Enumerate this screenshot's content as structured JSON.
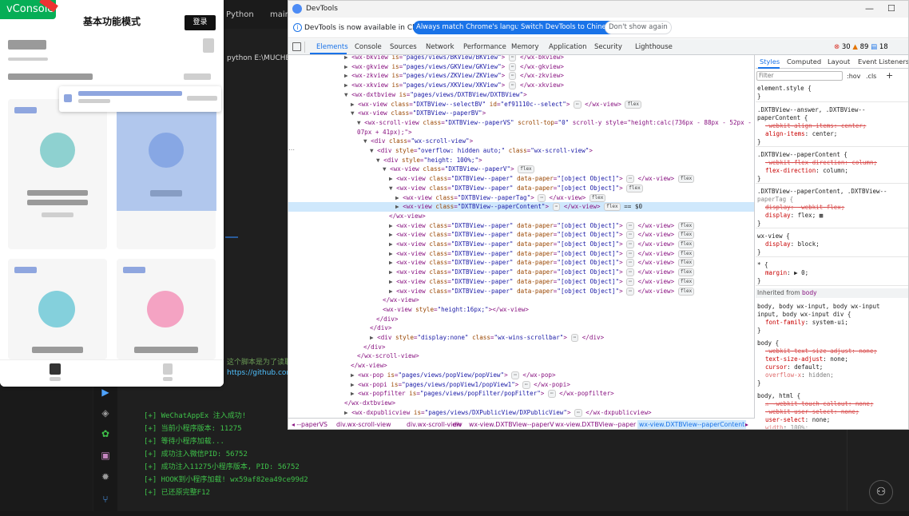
{
  "ide": {
    "topbar_python": "Python",
    "topbar_branch": "main",
    "left_path": "python E:\\MUCHEN-",
    "left_comment": "这个脚本是为了读取微信小程序的相关名称信息的名称。",
    "left_url": "https://github.com/J",
    "terminal": [
      "[+] WeChatAppEx 注入成功!",
      "[+] 当前小程序版本: 11275",
      "[+] 等待小程序加载...",
      "[+] 成功注入微信PID: 56752",
      "[+] 成功注入11275小程序版本, PID: 56752",
      "[+] HOOK到小程序加载! wx59af82ea49ce99d2",
      "[+] 已还原完整F12"
    ],
    "activity_icons": [
      "run-icon",
      "extensions-icon",
      "settings-icon",
      "terminal-icon",
      "debug-icon",
      "source-control-icon"
    ]
  },
  "sim": {
    "vconsole_label": "vConsole",
    "title": "基本功能模式",
    "login": "登录"
  },
  "devtools": {
    "title": "DevTools",
    "window_controls": [
      "—",
      "☐"
    ],
    "infobar": {
      "text": "DevTools is now available in Chinese!",
      "btn_match": "Always match Chrome's language",
      "btn_switch": "Switch DevTools to Chinese",
      "btn_dismiss": "Don't show again"
    },
    "tabs": [
      "Elements",
      "Console",
      "Sources",
      "Network",
      "Performance",
      "Memory",
      "Application",
      "Security",
      "Lighthouse"
    ],
    "issues": {
      "errors": "30",
      "warnings": "89",
      "messages": "18"
    },
    "dom_lines": [
      {
        "indent": 0,
        "t": "▶",
        "html": "<wx-bkview is=\"pages/views/BKView/BKView\"> ⋯ </wx-bkview>"
      },
      {
        "indent": 0,
        "t": "▶",
        "html": "<wx-gkview is=\"pages/views/GKView/GKView\"> ⋯ </wx-gkview>"
      },
      {
        "indent": 0,
        "t": "▶",
        "html": "<wx-zkview is=\"pages/views/ZKView/ZKView\"> ⋯ </wx-zkview>"
      },
      {
        "indent": 0,
        "t": "▶",
        "html": "<wx-xkview is=\"pages/views/XKView/XKView\"> ⋯ </wx-xkview>"
      },
      {
        "indent": 0,
        "t": "▼",
        "html": "<wx-dxtbview is=\"pages/views/DXTBView/DXTBView\">"
      },
      {
        "indent": 1,
        "t": "▶",
        "html": "<wx-view class=\"DXTBView--selectBV\" id=\"ef91110c--select\"> ⋯ </wx-view>",
        "badge": "flex"
      },
      {
        "indent": 1,
        "t": "▼",
        "html": "<wx-view class=\"DXTBView--paperBV\">"
      },
      {
        "indent": 2,
        "t": "▼",
        "html": "<wx-scroll-view class=\"DXTBView--paperVS\" scroll-top=\"0\" scroll-y style=\"height:calc(736px - 88px - 52px - 1"
      },
      {
        "indent": 2,
        "t": "",
        "html": "07px + 41px);\">"
      },
      {
        "indent": 3,
        "t": "▼",
        "html": "<div class=\"wx-scroll-view\">"
      },
      {
        "indent": 4,
        "t": "▼",
        "html": "<div style=\"overflow: hidden auto;\" class=\"wx-scroll-view\">"
      },
      {
        "indent": 5,
        "t": "▼",
        "html": "<div style=\"height: 100%;\">"
      },
      {
        "indent": 6,
        "t": "▼",
        "html": "<wx-view class=\"DXTBView--paperV\">",
        "badge": "flex"
      },
      {
        "indent": 7,
        "t": "▶",
        "html": "<wx-view class=\"DXTBView--paper\" data-paper=\"[object Object]\"> ⋯ </wx-view>",
        "badge": "flex"
      },
      {
        "indent": 7,
        "t": "▼",
        "html": "<wx-view class=\"DXTBView--paper\" data-paper=\"[object Object]\">",
        "badge": "flex"
      },
      {
        "indent": 8,
        "t": "▶",
        "html": "<wx-view class=\"DXTBView--paperTag\"> ⋯ </wx-view>",
        "badge": "flex"
      },
      {
        "indent": 8,
        "t": "▶",
        "html": "<wx-view class=\"DXTBView--paperContent\"> ⋯ </wx-view>",
        "badge": "flex",
        "sel": true,
        "suffix": " == $0"
      },
      {
        "indent": 7,
        "t": "",
        "html": "</wx-view>"
      },
      {
        "indent": 7,
        "t": "▶",
        "html": "<wx-view class=\"DXTBView--paper\" data-paper=\"[object Object]\"> ⋯ </wx-view>",
        "badge": "flex"
      },
      {
        "indent": 7,
        "t": "▶",
        "html": "<wx-view class=\"DXTBView--paper\" data-paper=\"[object Object]\"> ⋯ </wx-view>",
        "badge": "flex"
      },
      {
        "indent": 7,
        "t": "▶",
        "html": "<wx-view class=\"DXTBView--paper\" data-paper=\"[object Object]\"> ⋯ </wx-view>",
        "badge": "flex"
      },
      {
        "indent": 7,
        "t": "▶",
        "html": "<wx-view class=\"DXTBView--paper\" data-paper=\"[object Object]\"> ⋯ </wx-view>",
        "badge": "flex"
      },
      {
        "indent": 7,
        "t": "▶",
        "html": "<wx-view class=\"DXTBView--paper\" data-paper=\"[object Object]\"> ⋯ </wx-view>",
        "badge": "flex"
      },
      {
        "indent": 7,
        "t": "▶",
        "html": "<wx-view class=\"DXTBView--paper\" data-paper=\"[object Object]\"> ⋯ </wx-view>",
        "badge": "flex"
      },
      {
        "indent": 7,
        "t": "▶",
        "html": "<wx-view class=\"DXTBView--paper\" data-paper=\"[object Object]\"> ⋯ </wx-view>",
        "badge": "flex"
      },
      {
        "indent": 7,
        "t": "▶",
        "html": "<wx-view class=\"DXTBView--paper\" data-paper=\"[object Object]\"> ⋯ </wx-view>",
        "badge": "flex"
      },
      {
        "indent": 6,
        "t": "",
        "html": "</wx-view>"
      },
      {
        "indent": 6,
        "t": "",
        "html": "<wx-view style=\"height:16px;\"></wx-view>"
      },
      {
        "indent": 5,
        "t": "",
        "html": "</div>"
      },
      {
        "indent": 4,
        "t": "",
        "html": "</div>"
      },
      {
        "indent": 4,
        "t": "▶",
        "html": "<div style=\"display:none\" class=\"wx-wins-scrollbar\"> ⋯ </div>"
      },
      {
        "indent": 3,
        "t": "",
        "html": "</div>"
      },
      {
        "indent": 2,
        "t": "",
        "html": "</wx-scroll-view>"
      },
      {
        "indent": 1,
        "t": "",
        "html": "</wx-view>"
      },
      {
        "indent": 1,
        "t": "▶",
        "html": "<wx-pop is=\"pages/views/popView/popView\"> ⋯ </wx-pop>"
      },
      {
        "indent": 1,
        "t": "▶",
        "html": "<wx-popi is=\"pages/views/popView1/popView1\"> ⋯ </wx-popi>"
      },
      {
        "indent": 1,
        "t": "▶",
        "html": "<wx-popfilter is=\"pages/views/popFilter/popFilter\"> ⋯ </wx-popfilter>"
      },
      {
        "indent": 0,
        "t": "",
        "html": "</wx-dxtbview>"
      },
      {
        "indent": 0,
        "t": "▶",
        "html": "<wx-dxpublicview is=\"pages/views/DXPublicView/DXPublicView\"> ⋯ </wx-dxpublicview>"
      }
    ],
    "breadcrumbs": [
      "◂ --paperVS",
      "div.wx-scroll-view",
      "div.wx-scroll-view",
      "div",
      "wx-view.DXTBView--paperV",
      "wx-view.DXTBView--paper",
      "wx-view.DXTBView--paperContent",
      "▸"
    ],
    "styles": {
      "tabs": [
        "Styles",
        "Computed",
        "Layout",
        "Event Listeners"
      ],
      "filter_placeholder": "Filter",
      "hov": ":hov",
      "cls": ".cls",
      "plus": "+",
      "inherited_label": "Inherited from",
      "inherited_tag": "body"
    }
  }
}
